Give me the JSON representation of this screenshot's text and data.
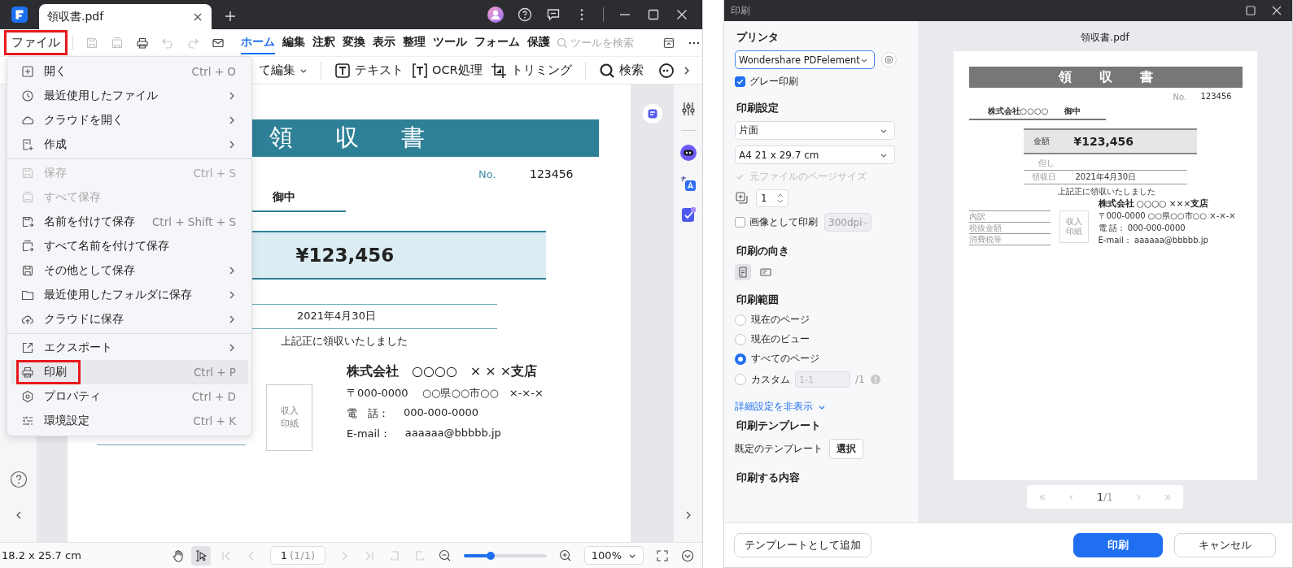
{
  "editor": {
    "tabs": [
      {
        "title": "領収書.pdf",
        "selected": true
      }
    ],
    "file_button": {
      "label": "ファイル",
      "highlighted": true
    },
    "ribbon_tabs": [
      {
        "label": "ホーム",
        "selected": true
      },
      {
        "label": "編集",
        "selected": false
      },
      {
        "label": "注釈",
        "selected": false
      },
      {
        "label": "変換",
        "selected": false
      },
      {
        "label": "表示",
        "selected": false
      },
      {
        "label": "整理",
        "selected": false
      },
      {
        "label": "ツール",
        "selected": false
      },
      {
        "label": "フォーム",
        "selected": false
      },
      {
        "label": "保護",
        "selected": false
      }
    ],
    "tool_search": {
      "placeholder": "ツールを検索"
    },
    "toolbar": [
      {
        "label": "て編集",
        "kind": "dropdown"
      },
      {
        "label": "テキスト",
        "kind": "text"
      },
      {
        "label": "OCR処理",
        "kind": "ocr"
      },
      {
        "label": "トリミング",
        "kind": "crop"
      },
      {
        "label": "検索",
        "kind": "search"
      }
    ],
    "file_menu": {
      "groups": [
        {
          "items": [
            {
              "label": "開く",
              "shortcut": "Ctrl + O",
              "submenu": false,
              "disabled": false,
              "highlighted": false
            },
            {
              "label": "最近使用したファイル",
              "submenu": true,
              "disabled": false,
              "highlighted": false
            },
            {
              "label": "クラウドを開く",
              "submenu": true,
              "disabled": false,
              "highlighted": false
            },
            {
              "label": "作成",
              "submenu": true,
              "disabled": false,
              "highlighted": false
            }
          ]
        },
        {
          "items": [
            {
              "label": "保存",
              "shortcut": "Ctrl + S",
              "submenu": false,
              "disabled": true,
              "highlighted": false
            },
            {
              "label": "すべて保存",
              "submenu": false,
              "disabled": true,
              "highlighted": false
            },
            {
              "label": "名前を付けて保存",
              "shortcut": "Ctrl + Shift + S",
              "submenu": false,
              "disabled": false,
              "highlighted": false
            },
            {
              "label": "すべて名前を付けて保存",
              "submenu": false,
              "disabled": false,
              "highlighted": false
            },
            {
              "label": "その他として保存",
              "submenu": true,
              "disabled": false,
              "highlighted": false
            },
            {
              "label": "最近使用したフォルダに保存",
              "submenu": true,
              "disabled": false,
              "highlighted": false
            },
            {
              "label": "クラウドに保存",
              "submenu": true,
              "disabled": false,
              "highlighted": false
            }
          ]
        },
        {
          "items": [
            {
              "label": "エクスポート",
              "submenu": true,
              "disabled": false,
              "highlighted": false
            },
            {
              "label": "印刷",
              "shortcut": "Ctrl + P",
              "submenu": false,
              "disabled": false,
              "highlighted": true
            },
            {
              "label": "プロパティ",
              "shortcut": "Ctrl + D",
              "submenu": false,
              "disabled": false,
              "highlighted": false
            },
            {
              "label": "環境設定",
              "shortcut": "Ctrl + K",
              "submenu": false,
              "disabled": false,
              "highlighted": false
            }
          ]
        }
      ]
    },
    "document": {
      "title_chars": [
        "領",
        "収",
        "書"
      ],
      "no_label": "No.",
      "no": "123456",
      "honorific": "御中",
      "amount": "¥123,456",
      "date": "2021年4月30日",
      "confirmation": "上記正に領収いたしました",
      "stamp": [
        "収入",
        "印紙"
      ],
      "company": "**株式会社**　○○○○　× × ×**支店**",
      "address": "〒000-0000　 ○○県○○市○○　×-×-×",
      "phone_label": "電　話：",
      "phone": "000-000-0000",
      "email_label": "E-mail：",
      "email": "aaaaaa@bbbbb.jp"
    },
    "status_bar": {
      "page_size": "18.2 x 25.7 cm",
      "page": "1",
      "page_count": "(1/1)",
      "zoom_slider": {
        "level": 0.32
      },
      "zoom": "100%"
    }
  },
  "print_dialog": {
    "title": "印刷",
    "printer_heading": "プリンタ",
    "printer": "Wondershare PDFelement",
    "grayscale": {
      "label": "グレー印刷",
      "checked": true
    },
    "settings_heading": "印刷設定",
    "sides": "片面",
    "paper": "A4 21 x 29.7 cm",
    "original_size": {
      "label": "元ファイルのページサイズ",
      "checked": true,
      "disabled": true
    },
    "copies": "1",
    "as_image": {
      "label": "画像として印刷",
      "checked": false
    },
    "dpi": "300dpi",
    "orientation_heading": "印刷の向き",
    "orientations": [
      {
        "kind": "portrait",
        "selected": true
      },
      {
        "kind": "landscape",
        "selected": false
      }
    ],
    "range_heading": "印刷範囲",
    "ranges": [
      {
        "label": "現在のページ",
        "selected": false
      },
      {
        "label": "現在のビュー",
        "selected": false
      },
      {
        "label": "すべてのページ",
        "selected": true
      },
      {
        "label": "カスタム",
        "selected": false,
        "input": {
          "placeholder": "1-1"
        },
        "suffix": "/1"
      }
    ],
    "advanced_link": "詳細設定を非表示",
    "template_heading": "印刷テンプレート",
    "template_label": "既定のテンプレート",
    "template_button": "選択",
    "content_heading": "印刷する内容",
    "add_template_button": "テンプレートとして追加",
    "print_button": "印刷",
    "cancel_button": "キャンセル",
    "preview": {
      "filename": "領収書.pdf",
      "page": "1",
      "total": "/1",
      "document": {
        "title_chars": [
          "領",
          "収",
          "書"
        ],
        "no_label": "No.",
        "no": "123456",
        "addressee": "株式会社○○○○",
        "honorific": "御中",
        "amount_label": "金額",
        "amount": "¥123,456",
        "note_label": "但し",
        "date_label": "領収日",
        "date": "2021年4月30日",
        "confirmation": "上記正に領収いたしました",
        "breakdown": [
          "内訳",
          "税抜金額",
          "消費税等"
        ],
        "stamp": [
          "収入",
          "印紙"
        ],
        "company": "**株式会社** ○○○○ ×××**支店**",
        "address": "〒000-0000 ○○県○○市○○ ×-×-×",
        "phone": "電 話： 000-000-0000",
        "email": "E-mail： aaaaaa@bbbbb.jp"
      }
    }
  }
}
